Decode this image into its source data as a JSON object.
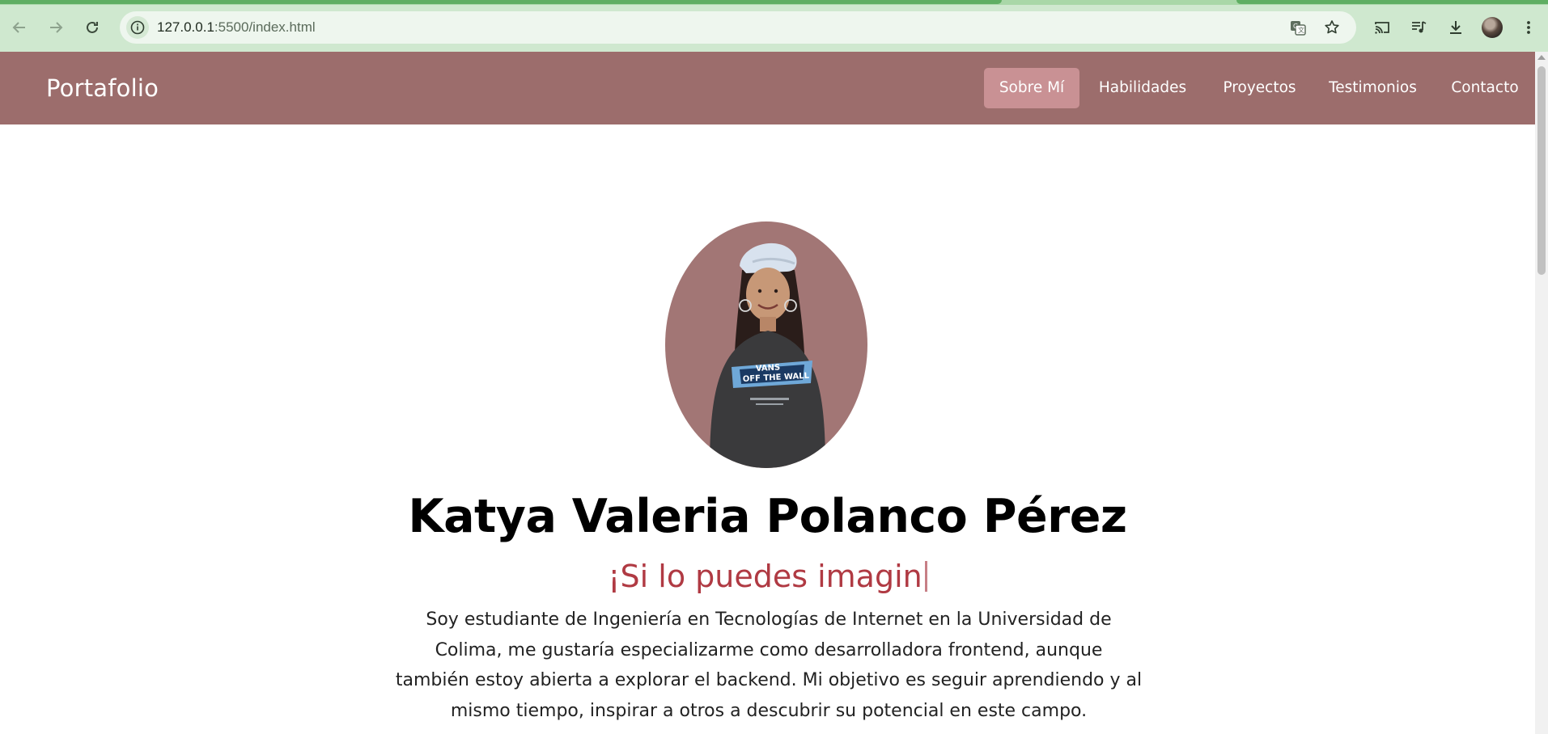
{
  "browser": {
    "url_host": "127.0.0.1",
    "url_rest": ":5500/index.html",
    "icons": {
      "back": "arrow-left-icon",
      "forward": "arrow-right-icon",
      "reload": "reload-icon",
      "site_info": "info-icon",
      "translate": "translate-icon",
      "bookmark": "star-icon",
      "cast": "cast-icon",
      "media": "media-queue-icon",
      "downloads": "download-icon",
      "profile": "profile-avatar",
      "menu": "kebab-menu-icon"
    }
  },
  "header": {
    "brand": "Portafolio",
    "nav": [
      {
        "label": "Sobre Mí",
        "active": true
      },
      {
        "label": "Habilidades",
        "active": false
      },
      {
        "label": "Proyectos",
        "active": false
      },
      {
        "label": "Testimonios",
        "active": false
      },
      {
        "label": "Contacto",
        "active": false
      }
    ]
  },
  "hero": {
    "name": "Katya Valeria Polanco Pérez",
    "typing_text": "¡Si lo puedes imagin",
    "bio_lines": [
      "Soy estudiante de Ingeniería en Tecnologías de Internet en la Universidad de",
      "Colima, me gustaría especializarme como desarrolladora frontend, aunque",
      "también estoy abierta a explorar el backend. Mi objetivo es seguir aprendiendo y al",
      "mismo tiempo, inspirar a otros a descubrir su potencial en este campo."
    ],
    "portrait_shirt_text": "VANS OFF THE WALL"
  },
  "colors": {
    "header_bg": "#9c6d6c",
    "nav_active_bg": "#c99194",
    "accent_text": "#b03a43",
    "portrait_bg": "#a27675"
  }
}
